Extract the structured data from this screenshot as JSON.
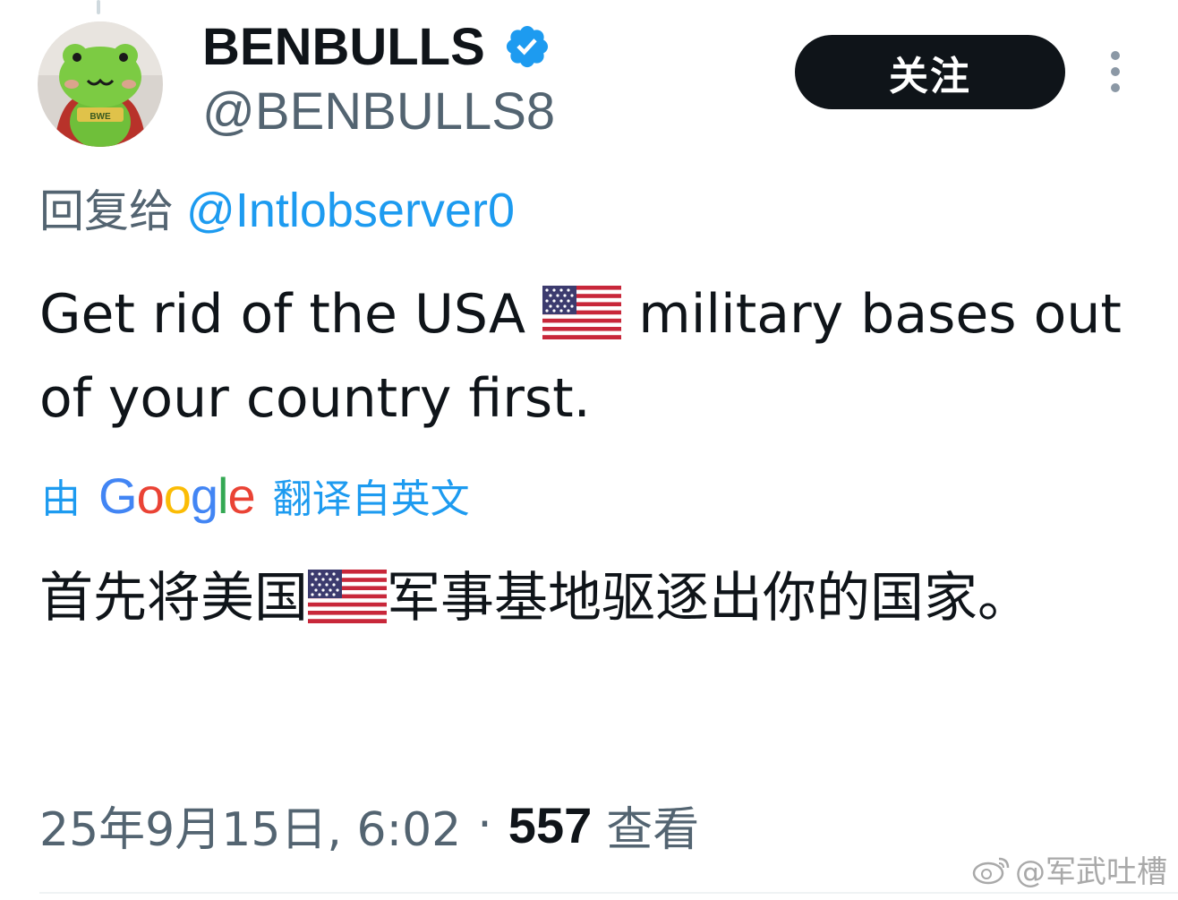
{
  "author": {
    "display_name": "BENBULLS",
    "handle": "@BENBULLS8",
    "verified": true,
    "avatar_icon": "green-frog-superhero-plush-icon"
  },
  "actions": {
    "follow_label": "关注",
    "more_icon": "vertical-ellipsis-icon"
  },
  "reply": {
    "prefix": "回复给",
    "mention": "@Intlobserver0"
  },
  "tweet": {
    "text_part1": "Get rid of the USA ",
    "text_part2": " military bases out of your country first.",
    "flag_emoji": "us-flag-icon"
  },
  "translation": {
    "by": "由",
    "provider": "Google",
    "suffix": "翻译自英文",
    "text_part1": "首先将美国",
    "text_part2": "军事基地驱逐出你的国家。"
  },
  "meta": {
    "timestamp": "25年9月15日, 6:02",
    "separator": "·",
    "view_count": "557",
    "view_label": "查看"
  },
  "watermark": {
    "text": "@军武吐槽",
    "icon": "weibo-logo-icon"
  },
  "colors": {
    "accent": "#1d9bf0",
    "text_primary": "#0f1419",
    "text_secondary": "#536471",
    "button_bg": "#0f1419"
  }
}
